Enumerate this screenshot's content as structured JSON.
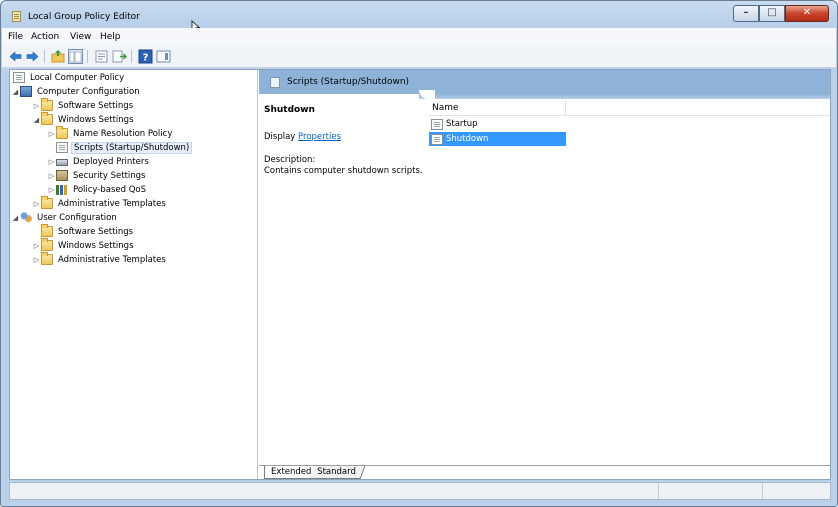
{
  "window": {
    "title": "Local Group Policy Editor",
    "controls": {
      "minimize": "–",
      "maximize": "□",
      "close": "✕"
    }
  },
  "menu": [
    "File",
    "Action",
    "View",
    "Help"
  ],
  "toolbar_icons": [
    "back-icon",
    "forward-icon",
    "up-folder-icon",
    "show-hide-tree-icon",
    "export-list-icon",
    "properties-icon",
    "help-icon",
    "show-action-pane-icon"
  ],
  "tree": {
    "root": "Local Computer Policy",
    "computer_configuration": "Computer Configuration",
    "cc_software_settings": "Software Settings",
    "cc_windows_settings": "Windows Settings",
    "name_resolution_policy": "Name Resolution Policy",
    "scripts": "Scripts (Startup/Shutdown)",
    "deployed_printers": "Deployed Printers",
    "security_settings": "Security Settings",
    "policy_qos": "Policy-based QoS",
    "cc_admin_templates": "Administrative Templates",
    "user_configuration": "User Configuration",
    "uc_software_settings": "Software Settings",
    "uc_windows_settings": "Windows Settings",
    "uc_admin_templates": "Administrative Templates"
  },
  "details": {
    "header": "Scripts (Startup/Shutdown)",
    "selected_title": "Shutdown",
    "display_prefix": "Display",
    "display_link": "Properties",
    "description_label": "Description:",
    "description": "Contains computer shutdown scripts."
  },
  "list": {
    "column_name": "Name",
    "items": [
      "Startup",
      "Shutdown"
    ],
    "selected_index": 1
  },
  "tabs": [
    "Extended",
    "Standard"
  ],
  "colors": {
    "selection": "#3399ff",
    "header_band": "#8fb2d8",
    "link": "#0a61c9",
    "frame": "#b9d1ea"
  }
}
